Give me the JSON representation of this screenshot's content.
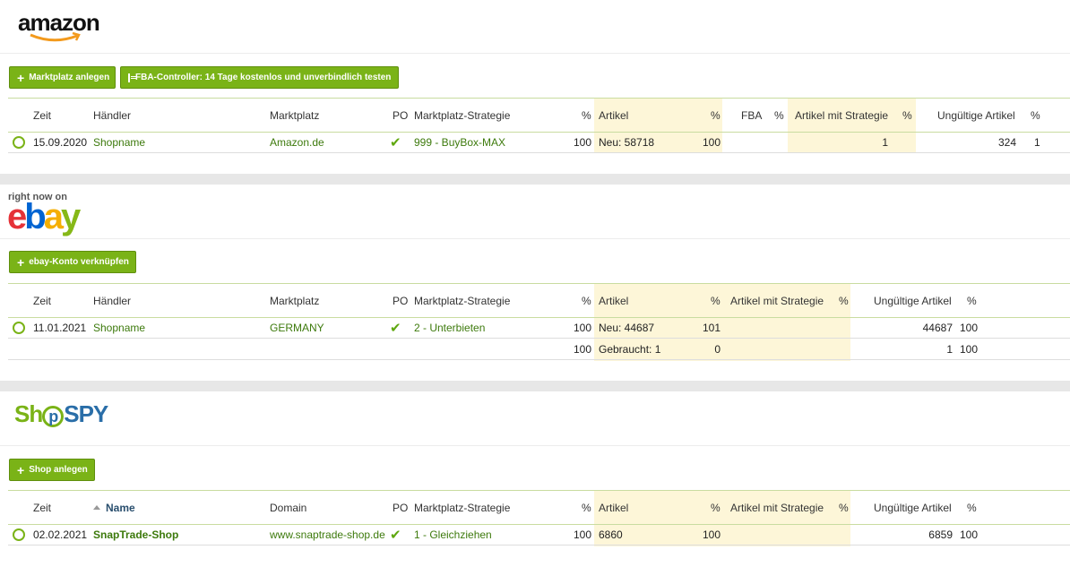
{
  "amazon": {
    "logo_text": "amazon",
    "buttons": [
      {
        "label": "Marktplatz anlegen",
        "icon": "plus-icon"
      },
      {
        "label": "FBA-Controller: 14 Tage kostenlos und unverbindlich testen",
        "icon": "store-icon"
      }
    ],
    "headers": [
      "Zeit",
      "Händler",
      "Marktplatz",
      "PO",
      "Marktplatz-Strategie",
      "%",
      "Artikel",
      "%",
      "FBA",
      "%",
      "Artikel mit Strategie",
      "%",
      "Ungültige Artikel",
      "%"
    ],
    "rows": [
      {
        "zeit": "15.09.2020",
        "haendler": "Shopname",
        "marktplatz": "Amazon.de",
        "strategie": "999 - BuyBox-MAX",
        "pct1": "100",
        "artikel": "Neu: 58718",
        "pct2": "100",
        "fba": "",
        "pct3": "",
        "mit_strategie": "1",
        "pct4": "",
        "ungueltig": "324",
        "pct5": "1"
      }
    ]
  },
  "ebay": {
    "logo_top": "right now on",
    "logo_text": {
      "e": "e",
      "b": "b",
      "a": "a",
      "y": "y"
    },
    "buttons": [
      {
        "label": "ebay-Konto verknüpfen",
        "icon": "plus-icon"
      }
    ],
    "headers": [
      "Zeit",
      "Händler",
      "Marktplatz",
      "PO",
      "Marktplatz-Strategie",
      "%",
      "Artikel",
      "%",
      "Artikel mit Strategie",
      "%",
      "Ungültige Artikel",
      "%"
    ],
    "rows": [
      {
        "zeit": "11.01.2021",
        "haendler": "Shopname",
        "marktplatz": "GERMANY",
        "strategie": "2 - Unterbieten",
        "pct1": "100",
        "artikel": "Neu: 44687",
        "pct2": "101",
        "mit_strategie": "",
        "pct3": "",
        "ungueltig": "44687",
        "pct4": "100"
      },
      {
        "zeit": "",
        "haendler": "",
        "marktplatz": "",
        "strategie": "",
        "pct1": "100",
        "artikel": "Gebraucht: 1",
        "pct2": "0",
        "mit_strategie": "",
        "pct3": "",
        "ungueltig": "1",
        "pct4": "100"
      }
    ]
  },
  "shopspy": {
    "logo_text": {
      "part1": "Sh",
      "part2": "p",
      "part3": "SPY"
    },
    "buttons": [
      {
        "label": "Shop anlegen",
        "icon": "plus-icon"
      }
    ],
    "headers": [
      "Zeit",
      "Name",
      "Domain",
      "PO",
      "Marktplatz-Strategie",
      "%",
      "Artikel",
      "%",
      "Artikel mit Strategie",
      "%",
      "Ungültige Artikel",
      "%"
    ],
    "rows": [
      {
        "zeit": "02.02.2021",
        "name": "SnapTrade-Shop",
        "domain": "www.snaptrade-shop.de",
        "strategie": "1 - Gleichziehen",
        "pct1": "100",
        "artikel": "6860",
        "pct2": "100",
        "mit_strategie": "",
        "pct3": "",
        "ungueltig": "6859",
        "pct4": "100"
      }
    ]
  },
  "colors": {
    "accent": "#7ab317",
    "link": "#3d7a0c",
    "highlight": "#fdf6d8",
    "band": "#e7e7e7"
  }
}
